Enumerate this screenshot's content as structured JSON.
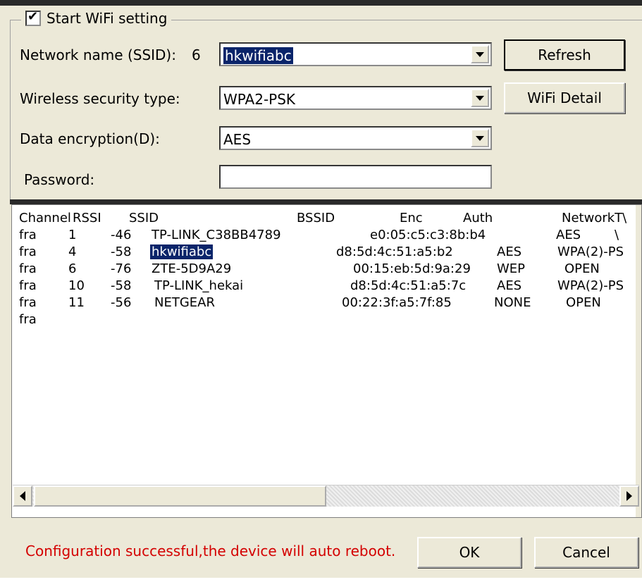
{
  "wifi_group": {
    "checkbox_label": "Start WiFi setting",
    "checked": true
  },
  "form": {
    "ssid_label": "Network name (SSID):",
    "ssid_count": "6",
    "ssid_value": "hkwifiabc",
    "security_label": "Wireless security type:",
    "security_value": "WPA2-PSK",
    "encryption_label": "Data encryption(D):",
    "encryption_value": "AES",
    "password_label": "Password:",
    "password_value": ""
  },
  "buttons": {
    "refresh": "Refresh",
    "wifi_detail": "WiFi Detail",
    "ok": "OK",
    "cancel": "Cancel"
  },
  "list": {
    "header": [
      "Channel",
      "RSSI",
      "SSID",
      "BSSID",
      "Enc",
      "Auth",
      "NetworkT\\"
    ],
    "rows": [
      [
        "fra",
        "1",
        "-46",
        "TP-LINK_C38BB4789",
        "e0:05:c5:c3:8b:b4",
        "AES",
        "\\"
      ],
      [
        "fra",
        "4",
        "-58",
        "hkwifiabc",
        "d8:5d:4c:51:a5:b2",
        "AES",
        "WPA(2)-PS"
      ],
      [
        "fra",
        "6",
        "-76",
        "ZTE-5D9A29",
        "00:15:eb:5d:9a:29",
        "WEP",
        "OPEN"
      ],
      [
        "fra",
        "10",
        "-58",
        "TP-LINK_hekai",
        "d8:5d:4c:51:a5:7c",
        "AES",
        "WPA(2)-PS"
      ],
      [
        "fra",
        "11",
        "-56",
        "NETGEAR",
        "00:22:3f:a5:7f:85",
        "NONE",
        "OPEN"
      ],
      [
        "fra",
        "",
        "",
        "",
        "",
        "",
        ""
      ]
    ]
  },
  "status": {
    "message": "Configuration successful,the device will auto reboot.",
    "color": "#d40000"
  },
  "icons": {
    "checkbox_tick": "✔",
    "combo_arrow": "chevron-down",
    "scroll_left": "triangle-left",
    "scroll_right": "triangle-right"
  }
}
